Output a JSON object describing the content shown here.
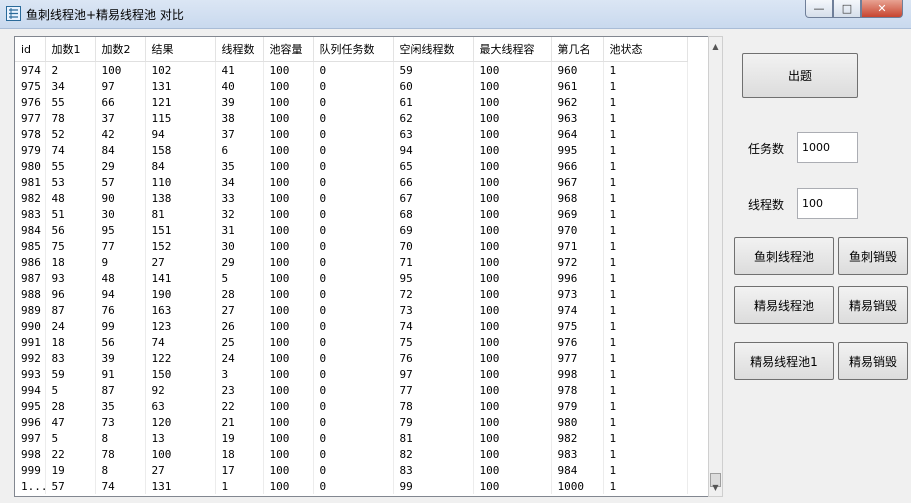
{
  "window": {
    "title": "鱼刺线程池+精易线程池 对比"
  },
  "table": {
    "headers": [
      "id",
      "加数1",
      "加数2",
      "结果",
      "线程数",
      "池容量",
      "队列任务数",
      "空闲线程数",
      "最大线程容",
      "第几名",
      "池状态"
    ],
    "rows": [
      [
        "974",
        "2",
        "100",
        "102",
        "41",
        "100",
        "0",
        "59",
        "100",
        "960",
        "1"
      ],
      [
        "975",
        "34",
        "97",
        "131",
        "40",
        "100",
        "0",
        "60",
        "100",
        "961",
        "1"
      ],
      [
        "976",
        "55",
        "66",
        "121",
        "39",
        "100",
        "0",
        "61",
        "100",
        "962",
        "1"
      ],
      [
        "977",
        "78",
        "37",
        "115",
        "38",
        "100",
        "0",
        "62",
        "100",
        "963",
        "1"
      ],
      [
        "978",
        "52",
        "42",
        "94",
        "37",
        "100",
        "0",
        "63",
        "100",
        "964",
        "1"
      ],
      [
        "979",
        "74",
        "84",
        "158",
        "6",
        "100",
        "0",
        "94",
        "100",
        "995",
        "1"
      ],
      [
        "980",
        "55",
        "29",
        "84",
        "35",
        "100",
        "0",
        "65",
        "100",
        "966",
        "1"
      ],
      [
        "981",
        "53",
        "57",
        "110",
        "34",
        "100",
        "0",
        "66",
        "100",
        "967",
        "1"
      ],
      [
        "982",
        "48",
        "90",
        "138",
        "33",
        "100",
        "0",
        "67",
        "100",
        "968",
        "1"
      ],
      [
        "983",
        "51",
        "30",
        "81",
        "32",
        "100",
        "0",
        "68",
        "100",
        "969",
        "1"
      ],
      [
        "984",
        "56",
        "95",
        "151",
        "31",
        "100",
        "0",
        "69",
        "100",
        "970",
        "1"
      ],
      [
        "985",
        "75",
        "77",
        "152",
        "30",
        "100",
        "0",
        "70",
        "100",
        "971",
        "1"
      ],
      [
        "986",
        "18",
        "9",
        "27",
        "29",
        "100",
        "0",
        "71",
        "100",
        "972",
        "1"
      ],
      [
        "987",
        "93",
        "48",
        "141",
        "5",
        "100",
        "0",
        "95",
        "100",
        "996",
        "1"
      ],
      [
        "988",
        "96",
        "94",
        "190",
        "28",
        "100",
        "0",
        "72",
        "100",
        "973",
        "1"
      ],
      [
        "989",
        "87",
        "76",
        "163",
        "27",
        "100",
        "0",
        "73",
        "100",
        "974",
        "1"
      ],
      [
        "990",
        "24",
        "99",
        "123",
        "26",
        "100",
        "0",
        "74",
        "100",
        "975",
        "1"
      ],
      [
        "991",
        "18",
        "56",
        "74",
        "25",
        "100",
        "0",
        "75",
        "100",
        "976",
        "1"
      ],
      [
        "992",
        "83",
        "39",
        "122",
        "24",
        "100",
        "0",
        "76",
        "100",
        "977",
        "1"
      ],
      [
        "993",
        "59",
        "91",
        "150",
        "3",
        "100",
        "0",
        "97",
        "100",
        "998",
        "1"
      ],
      [
        "994",
        "5",
        "87",
        "92",
        "23",
        "100",
        "0",
        "77",
        "100",
        "978",
        "1"
      ],
      [
        "995",
        "28",
        "35",
        "63",
        "22",
        "100",
        "0",
        "78",
        "100",
        "979",
        "1"
      ],
      [
        "996",
        "47",
        "73",
        "120",
        "21",
        "100",
        "0",
        "79",
        "100",
        "980",
        "1"
      ],
      [
        "997",
        "5",
        "8",
        "13",
        "19",
        "100",
        "0",
        "81",
        "100",
        "982",
        "1"
      ],
      [
        "998",
        "22",
        "78",
        "100",
        "18",
        "100",
        "0",
        "82",
        "100",
        "983",
        "1"
      ],
      [
        "999",
        "19",
        "8",
        "27",
        "17",
        "100",
        "0",
        "83",
        "100",
        "984",
        "1"
      ],
      [
        "1...",
        "57",
        "74",
        "131",
        "1",
        "100",
        "0",
        "99",
        "100",
        "1000",
        "1"
      ]
    ]
  },
  "controls": {
    "generate_button": "出题",
    "task_count_label": "任务数",
    "task_count_value": "1000",
    "thread_count_label": "线程数",
    "thread_count_value": "100",
    "fish_pool_button": "鱼刺线程池",
    "fish_destroy_button": "鱼刺销毁",
    "jingyi_pool_button": "精易线程池",
    "jingyi_destroy_button": "精易销毁",
    "jingyi_pool1_button": "精易线程池1",
    "jingyi_destroy2_button": "精易销毁"
  }
}
